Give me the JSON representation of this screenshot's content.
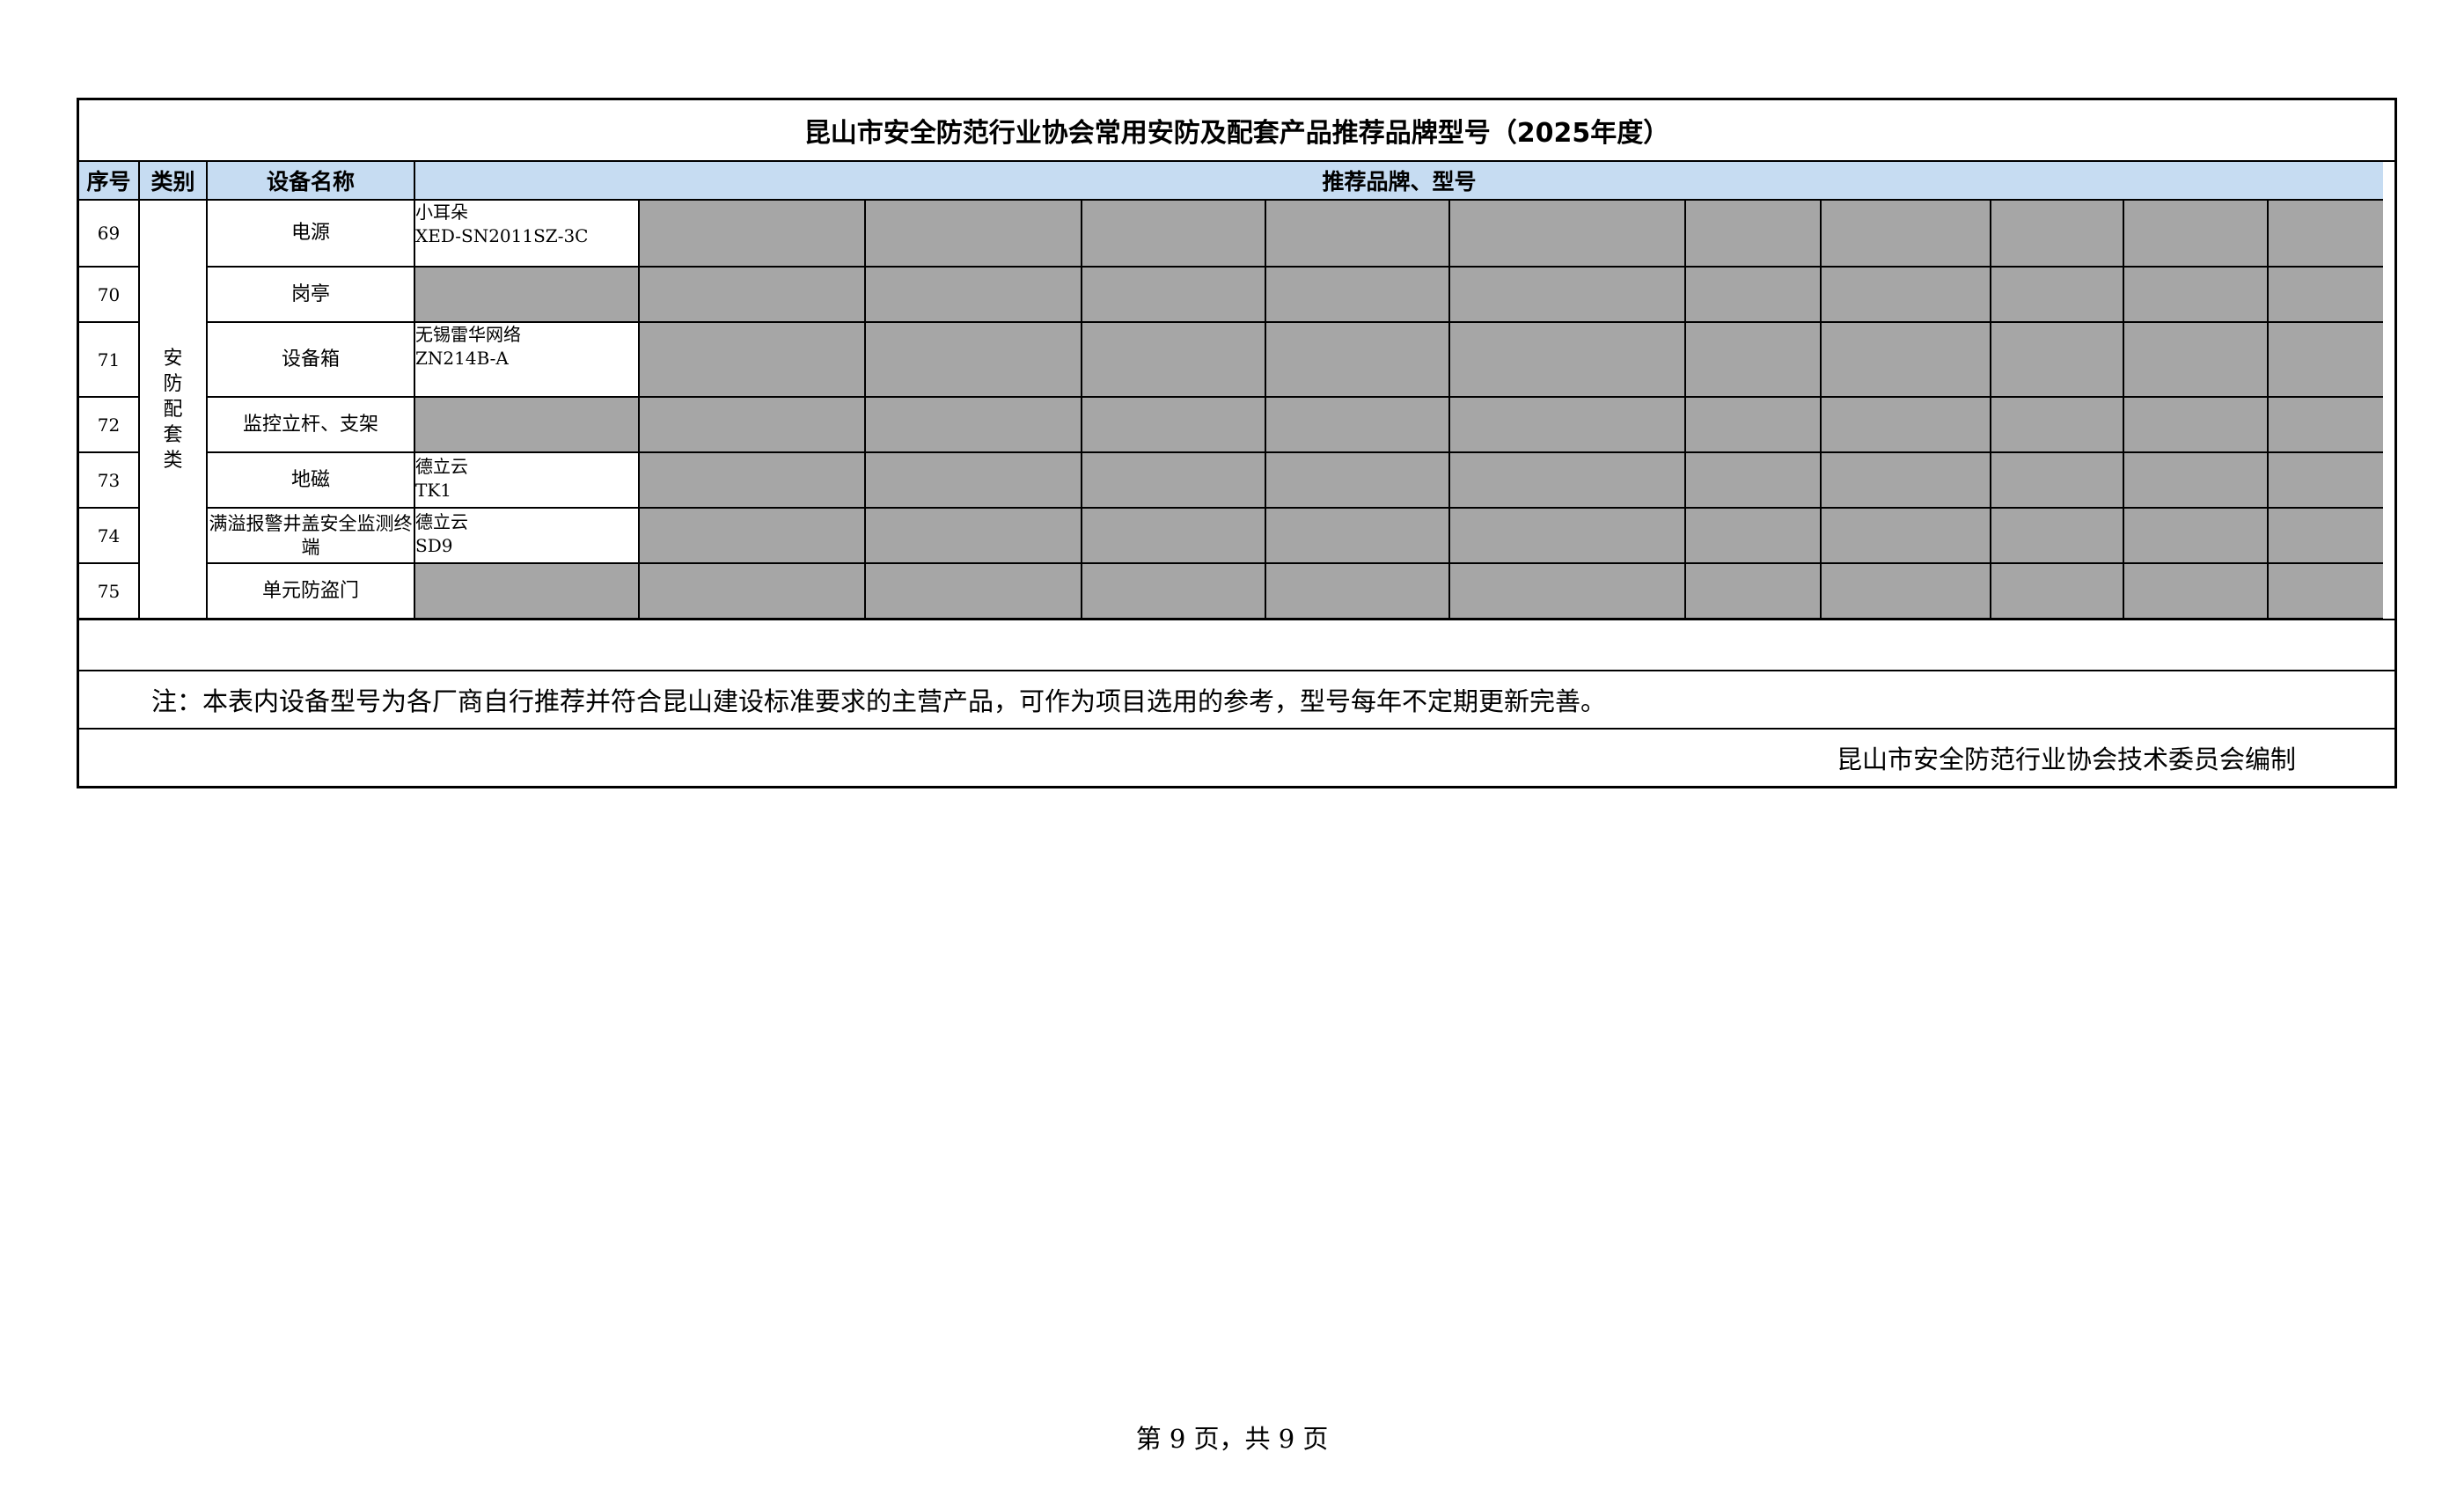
{
  "document": {
    "title": "昆山市安全防范行业协会常用安防及配套产品推荐品牌型号（2025年度）",
    "headers": {
      "seq": "序号",
      "category": "类别",
      "device": "设备名称",
      "brand": "推荐品牌、型号"
    },
    "category": "安防配套类",
    "rows": [
      {
        "seq": "69",
        "device": "电源",
        "brand": "小耳朵",
        "model": "XED-SN2011SZ-3C"
      },
      {
        "seq": "70",
        "device": "岗亭",
        "brand": "",
        "model": ""
      },
      {
        "seq": "71",
        "device": "设备箱",
        "brand": "无锡雷华网络",
        "model": "ZN214B-A"
      },
      {
        "seq": "72",
        "device": "监控立杆、支架",
        "brand": "",
        "model": ""
      },
      {
        "seq": "73",
        "device": "地磁",
        "brand": "德立云",
        "model": "TK1"
      },
      {
        "seq": "74",
        "device": "满溢报警井盖安全监测终端",
        "brand": "德立云",
        "model": "SD9"
      },
      {
        "seq": "75",
        "device": "单元防盗门",
        "brand": "",
        "model": ""
      }
    ],
    "note": "注：本表内设备型号为各厂商自行推荐并符合昆山建设标准要求的主营产品，可作为项目选用的参考，型号每年不定期更新完善。",
    "credit": "昆山市安全防范行业协会技术委员会编制"
  },
  "footer": {
    "page_text": "第 9 页，共 9 页"
  },
  "colors": {
    "header_bg": "#c6dcf2",
    "filler_gray": "#a6a6a6"
  }
}
